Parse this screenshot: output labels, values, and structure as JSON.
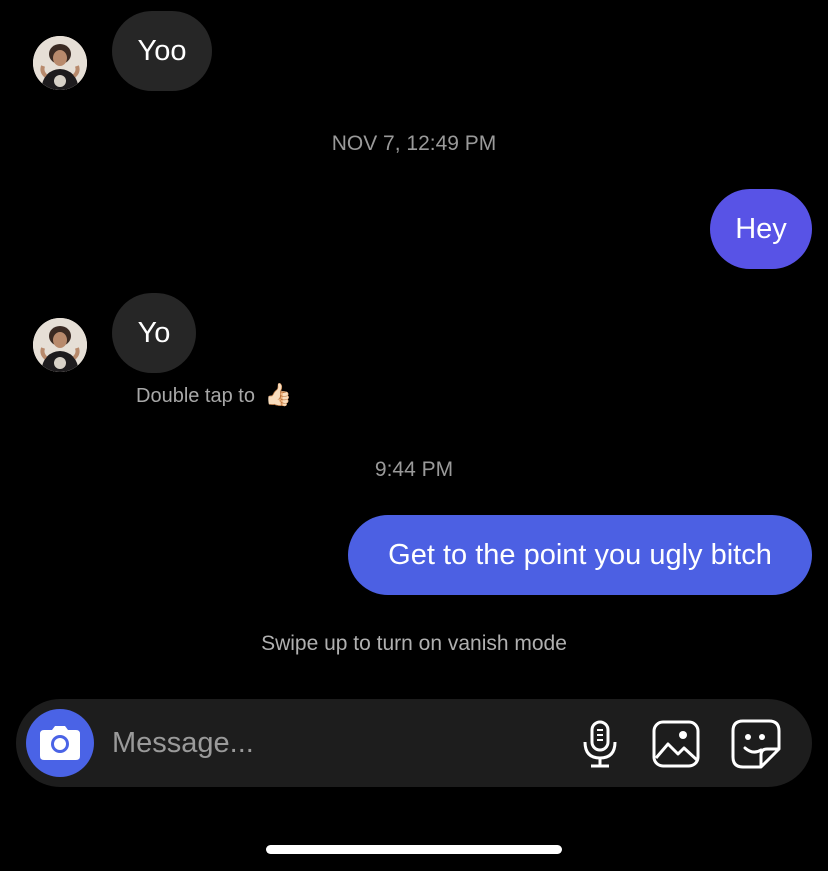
{
  "thread": {
    "messages": [
      {
        "sender": "them",
        "text": "Yoo"
      },
      {
        "sender": "me",
        "text": "Hey"
      },
      {
        "sender": "them",
        "text": "Yo"
      },
      {
        "sender": "me",
        "text": "Get to the point you ugly bitch"
      }
    ],
    "timestamps": [
      "NOV 7, 12:49 PM",
      "9:44 PM"
    ],
    "reaction_hint": "Double tap to",
    "reaction_emoji": "👍🏻",
    "vanish_hint": "Swipe up to turn on vanish mode"
  },
  "composer": {
    "placeholder": "Message...",
    "icons": [
      "camera-icon",
      "microphone-icon",
      "gallery-icon",
      "sticker-icon"
    ]
  },
  "colors": {
    "background": "#000000",
    "incoming_bubble": "#262626",
    "outgoing_bubble_1": "#5853e6",
    "outgoing_bubble_2": "#4c60e3",
    "camera_button": "#4a63e6"
  }
}
